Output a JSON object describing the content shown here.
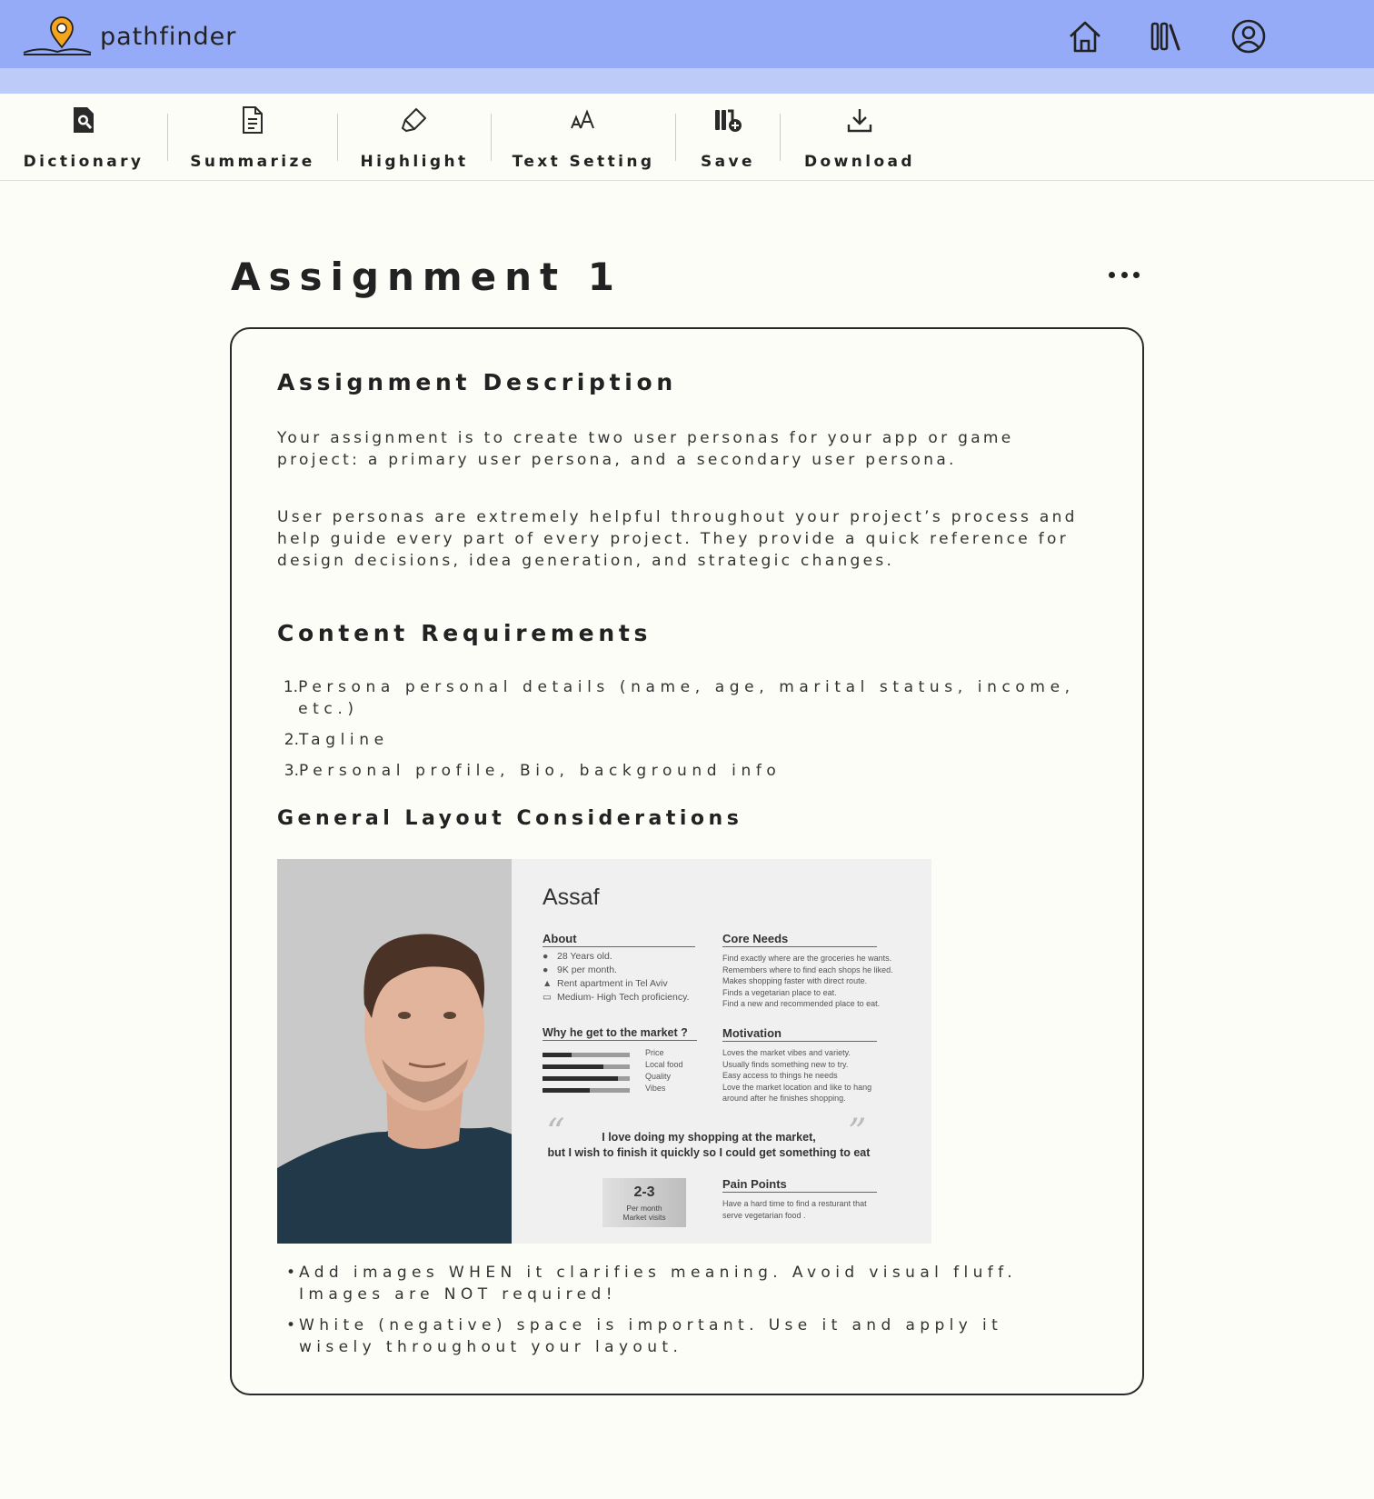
{
  "app": {
    "name": "pathfinder"
  },
  "nav": {
    "icons": [
      "home-icon",
      "library-icon",
      "account-icon"
    ]
  },
  "toolbar": {
    "items": [
      {
        "label": "Dictionary",
        "icon": "dictionary-search-icon"
      },
      {
        "label": "Summarize",
        "icon": "document-icon"
      },
      {
        "label": "Highlight",
        "icon": "highlighter-icon"
      },
      {
        "label": "Text Setting",
        "icon": "text-size-icon"
      },
      {
        "label": "Save",
        "icon": "save-to-library-icon"
      },
      {
        "label": "Download",
        "icon": "download-icon"
      }
    ]
  },
  "page": {
    "title": "Assignment 1"
  },
  "card": {
    "description": {
      "heading": "Assignment Description",
      "p1": "Your assignment is to create two user personas for your app or game project: a primary user persona, and a secondary user persona.",
      "p2": "User personas are extremely helpful throughout your project’s process and help guide every part of every project. They provide a quick reference for design decisions, idea generation, and strategic changes."
    },
    "requirements": {
      "heading": "Content Requirements",
      "items": [
        "Persona personal details (name, age, marital status, income, etc.)",
        "Tagline",
        "Personal profile, Bio, background info"
      ]
    },
    "layout": {
      "heading": "General Layout Considerations",
      "bullets": [
        "Add images WHEN it clarifies meaning. Avoid visual fluff. Images are NOT required!",
        "White (negative) space is important. Use it and apply it wisely throughout your layout."
      ]
    }
  },
  "persona": {
    "name": "Assaf",
    "about": {
      "heading": "About",
      "items": [
        "28 Years old.",
        "9K per month.",
        "Rent apartment in Tel Aviv",
        "Medium- High Tech proficiency."
      ]
    },
    "core_needs": {
      "heading": "Core Needs",
      "items": [
        "Find exactly where are the groceries he wants.",
        "Remembers where to find each shops he liked.",
        "Makes shopping faster with direct route.",
        "Finds a vegetarian place to eat.",
        "Find a new and recommended place to eat."
      ]
    },
    "why": {
      "heading": "Why he get to the market ?",
      "bars": [
        {
          "label": "Price",
          "value": 0.33
        },
        {
          "label": "Local food",
          "value": 0.7
        },
        {
          "label": "Quality",
          "value": 0.86
        },
        {
          "label": "Vibes",
          "value": 0.54
        }
      ]
    },
    "motivation": {
      "heading": "Motivation",
      "items": [
        "Loves the market vibes and variety.",
        "Usually finds something new to try.",
        "Easy access to things he needs",
        "Love the market location and like to hang",
        "around after he finishes shopping."
      ]
    },
    "quote": {
      "line1": "I love doing my shopping at the market,",
      "line2": "but I wish to finish it quickly so I could get something to eat"
    },
    "visits": {
      "number": "2-3",
      "line1": "Per month",
      "line2": "Market visits"
    },
    "pain_points": {
      "heading": "Pain Points",
      "items": [
        "Have a hard time to find a resturant that",
        "serve vegetarian food ."
      ]
    }
  }
}
